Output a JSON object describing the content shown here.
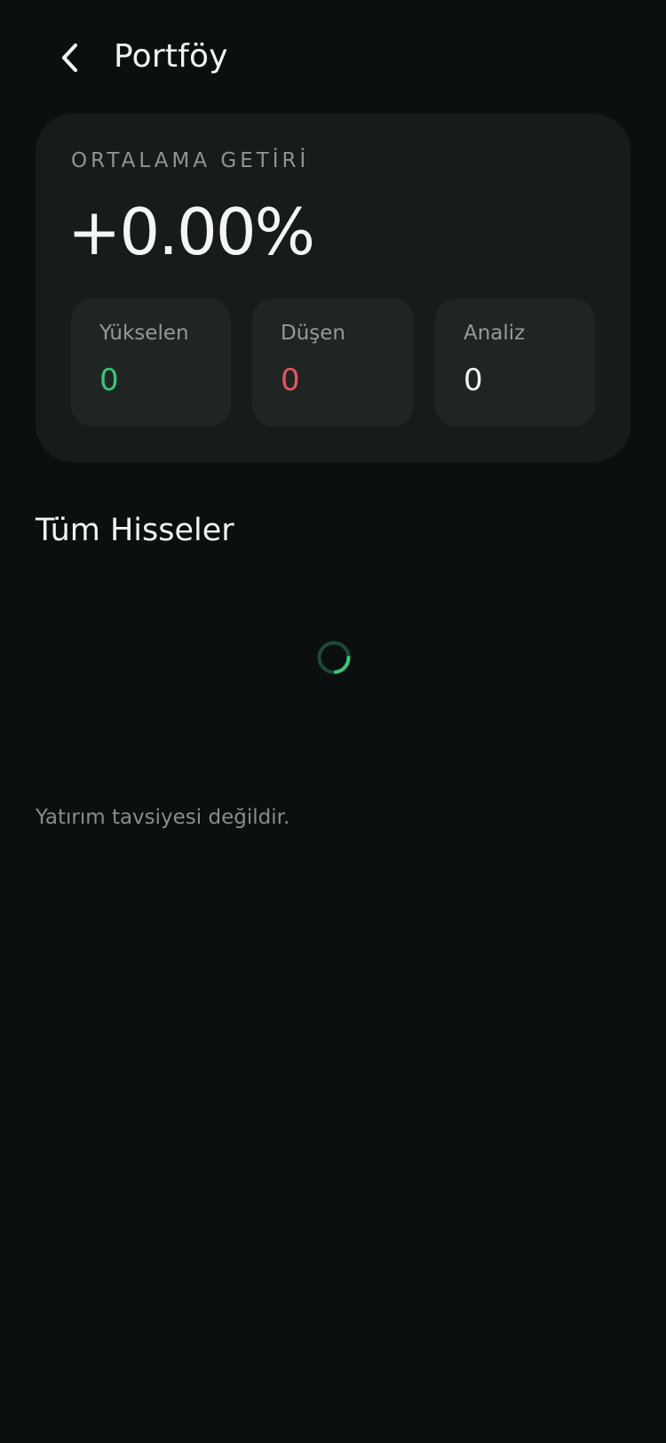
{
  "header": {
    "title": "Portföy",
    "back_icon": "chevron-left-icon"
  },
  "summary": {
    "label": "ORTALAMA GETİRİ",
    "value": "+0.00%",
    "stats": [
      {
        "label": "Yükselen",
        "value": "0",
        "color": "#35c97a"
      },
      {
        "label": "Düşen",
        "value": "0",
        "color": "#e8545f"
      },
      {
        "label": "Analiz",
        "value": "0",
        "color": "#f1f5f3"
      }
    ]
  },
  "section": {
    "title": "Tüm Hisseler",
    "loading_icon": "loading-spinner-icon"
  },
  "footer": {
    "disclaimer": "Yatırım tavsiyesi değildir."
  },
  "colors": {
    "background": "#0b0f0f",
    "card": "#171c1b",
    "stat_card": "#1f2523",
    "accent": "#35c97a"
  }
}
